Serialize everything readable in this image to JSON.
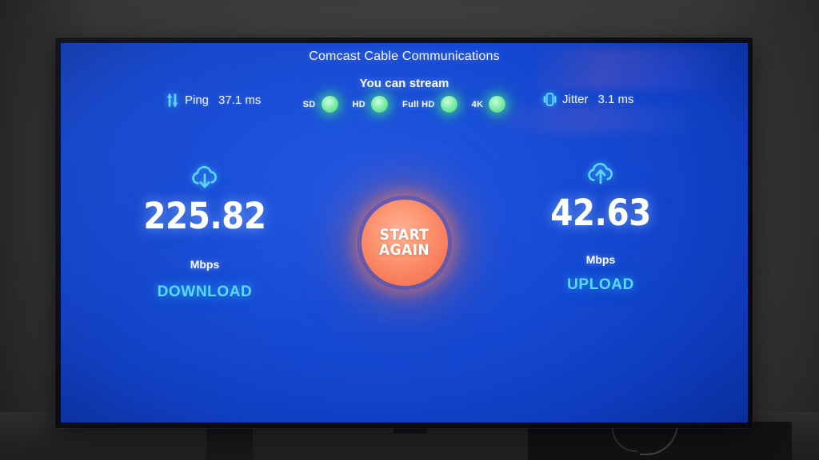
{
  "screen": {
    "isp_title": "Comcast Cable Communications",
    "ping": {
      "icon": "ping-arrows-icon",
      "label": "Ping",
      "value": "37.1 ms"
    },
    "jitter": {
      "icon": "jitter-pulse-icon",
      "label": "Jitter",
      "value": "3.1 ms"
    },
    "stream": {
      "heading": "You can stream",
      "items": [
        {
          "label": "SD",
          "status": "ok"
        },
        {
          "label": "HD",
          "status": "ok"
        },
        {
          "label": "Full HD",
          "status": "ok"
        },
        {
          "label": "4K",
          "status": "ok"
        }
      ]
    },
    "download": {
      "icon": "cloud-download-icon",
      "value": "225.82",
      "unit": "Mbps",
      "kind": "DOWNLOAD"
    },
    "upload": {
      "icon": "cloud-upload-icon",
      "value": "42.63",
      "unit": "Mbps",
      "kind": "UPLOAD"
    },
    "start_again": {
      "line1": "START",
      "line2": "AGAIN"
    }
  },
  "colors": {
    "background_blue": "#1549C8",
    "accent_cyan": "#5AD8FF",
    "status_green": "#5FE093",
    "button_orange": "#F9815F",
    "text_white": "#FFFFFF",
    "wall_gray": "#3E3E3E"
  }
}
